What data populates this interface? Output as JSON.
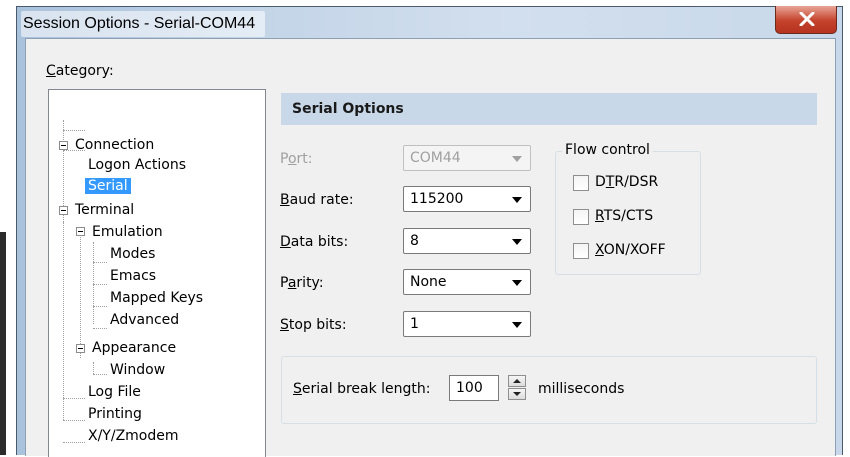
{
  "window": {
    "title": "Session Options - Serial-COM44"
  },
  "category": {
    "label": "Category:"
  },
  "tree": {
    "connection": "Connection",
    "logon_actions": "Logon Actions",
    "serial": "Serial",
    "terminal": "Terminal",
    "emulation": "Emulation",
    "modes": "Modes",
    "emacs": "Emacs",
    "mapped_keys": "Mapped Keys",
    "advanced": "Advanced",
    "appearance": "Appearance",
    "window": "Window",
    "log_file": "Log File",
    "printing": "Printing",
    "xyz": "X/Y/Zmodem"
  },
  "serial_options": {
    "header": "Serial Options",
    "port": {
      "label": "Port:",
      "value": "COM44"
    },
    "baud_rate": {
      "label": "Baud rate:",
      "value": "115200"
    },
    "data_bits": {
      "label": "Data bits:",
      "value": "8"
    },
    "parity": {
      "label": "Parity:",
      "value": "None"
    },
    "stop_bits": {
      "label": "Stop bits:",
      "value": "1"
    }
  },
  "flow_control": {
    "title": "Flow control",
    "dtr_dsr": "DTR/DSR",
    "rts_cts": "RTS/CTS",
    "xon_xoff": "XON/XOFF"
  },
  "serial_break": {
    "label": "Serial break length:",
    "value": "100",
    "unit": "milliseconds"
  }
}
